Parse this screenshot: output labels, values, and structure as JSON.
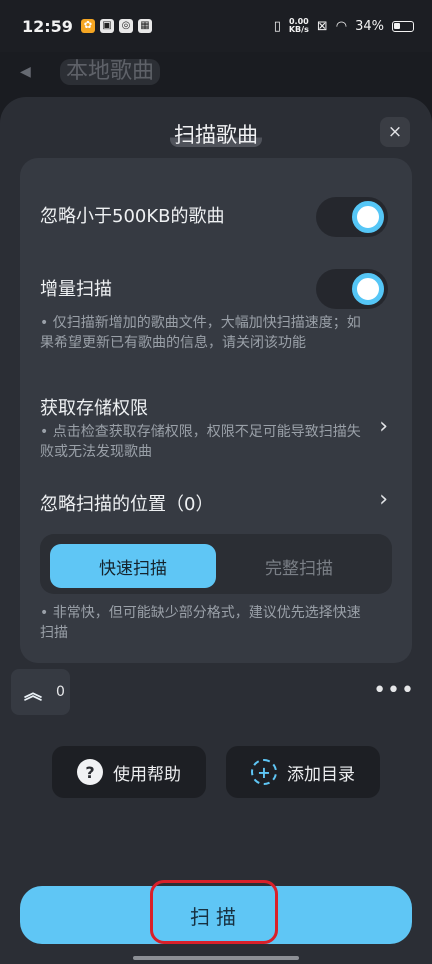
{
  "status_bar": {
    "time": "12:59",
    "network_speed_value": "0.00",
    "network_speed_unit": "KB/s",
    "battery": "34%"
  },
  "app_header": {
    "title": "本地歌曲"
  },
  "sheet": {
    "title": "扫描歌曲",
    "close_icon": "×",
    "settings": {
      "ignore_small": {
        "label": "忽略小于500KB的歌曲",
        "enabled": true
      },
      "incremental": {
        "label": "增量扫描",
        "enabled": true,
        "desc": "• 仅扫描新增加的歌曲文件，大幅加快扫描速度；如果希望更新已有歌曲的信息，请关闭该功能"
      },
      "storage_permission": {
        "label": "获取存储权限",
        "desc": "• 点击检查获取存储权限，权限不足可能导致扫描失败或无法发现歌曲"
      },
      "ignored_locations": {
        "label": "忽略扫描的位置（0）"
      }
    },
    "scan_mode": {
      "options": [
        "快速扫描",
        "完整扫描"
      ],
      "selected": "快速扫描",
      "desc": "• 非常快，但可能缺少部分格式，建议优先选择快速扫描"
    },
    "expand_count": "0",
    "help_button": "使用帮助",
    "add_dir_button": "添加目录",
    "scan_button": "扫描",
    "accent_color": "#5fc6f5",
    "highlight_color": "#d9202a"
  }
}
